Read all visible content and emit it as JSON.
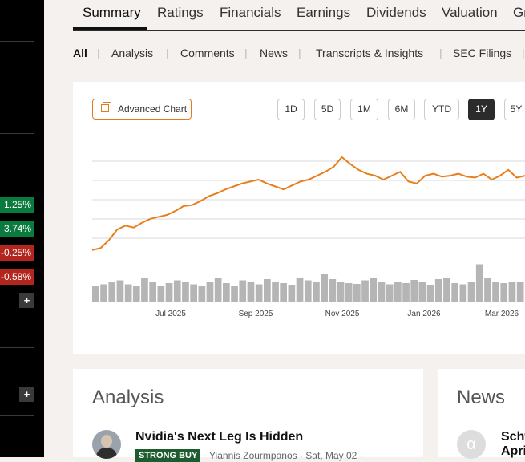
{
  "sidebar": {
    "changes": [
      {
        "value": "1.25%",
        "direction": "up"
      },
      {
        "value": "3.74%",
        "direction": "up"
      },
      {
        "value": "-0.25%",
        "direction": "down"
      },
      {
        "value": "-0.58%",
        "direction": "down"
      }
    ],
    "add_label": "+"
  },
  "tabs": [
    {
      "label": "Summary",
      "active": true
    },
    {
      "label": "Ratings"
    },
    {
      "label": "Financials"
    },
    {
      "label": "Earnings"
    },
    {
      "label": "Dividends"
    },
    {
      "label": "Valuation"
    },
    {
      "label": "Gr"
    }
  ],
  "subnav": [
    "All",
    "Analysis",
    "Comments",
    "News",
    "Transcripts & Insights",
    "SEC Filings"
  ],
  "chart_controls": {
    "advanced_label": "Advanced Chart",
    "ranges": [
      "1D",
      "5D",
      "1M",
      "6M",
      "YTD",
      "1Y",
      "5Y"
    ],
    "active_range": "1Y"
  },
  "chart_data": {
    "type": "line",
    "series": [
      {
        "values": [
          0.1,
          0.12,
          0.2,
          0.31,
          0.35,
          0.33,
          0.38,
          0.42,
          0.44,
          0.46,
          0.5,
          0.55,
          0.56,
          0.6,
          0.65,
          0.68,
          0.72,
          0.75,
          0.78,
          0.8,
          0.82,
          0.78,
          0.75,
          0.72,
          0.76,
          0.8,
          0.82,
          0.86,
          0.9,
          0.95,
          1.05,
          0.98,
          0.92,
          0.88,
          0.86,
          0.82,
          0.86,
          0.9,
          0.8,
          0.78,
          0.86,
          0.88,
          0.85,
          0.86,
          0.88,
          0.85,
          0.84,
          0.88,
          0.82,
          0.86,
          0.92,
          0.84,
          0.86
        ]
      }
    ],
    "volume": [
      0.4,
      0.45,
      0.5,
      0.55,
      0.45,
      0.4,
      0.6,
      0.5,
      0.42,
      0.48,
      0.55,
      0.5,
      0.45,
      0.4,
      0.52,
      0.6,
      0.48,
      0.42,
      0.55,
      0.5,
      0.45,
      0.58,
      0.52,
      0.48,
      0.44,
      0.62,
      0.55,
      0.5,
      0.7,
      0.58,
      0.52,
      0.48,
      0.46,
      0.55,
      0.6,
      0.5,
      0.45,
      0.52,
      0.48,
      0.56,
      0.5,
      0.44,
      0.58,
      0.62,
      0.48,
      0.45,
      0.52,
      0.95,
      0.6,
      0.5,
      0.48,
      0.52,
      0.5
    ],
    "xticks": [
      "Jul 2025",
      "Sep 2025",
      "Nov 2025",
      "Jan 2026",
      "Mar 2026"
    ],
    "grid": true,
    "colors": {
      "line": "#e87e1d",
      "volume": "#b5b5b5",
      "grid": "#d8d8d8"
    }
  },
  "analysis": {
    "heading": "Analysis",
    "article_title": "Nvidia's Next Leg Is Hidden",
    "badge": "STRONG BUY",
    "byline": "Yiannis Zourmpanos · Sat, May 02 ·"
  },
  "news": {
    "heading": "News",
    "icon_glyph": "α",
    "title_line1": "Schw",
    "title_line2": "Apri"
  }
}
